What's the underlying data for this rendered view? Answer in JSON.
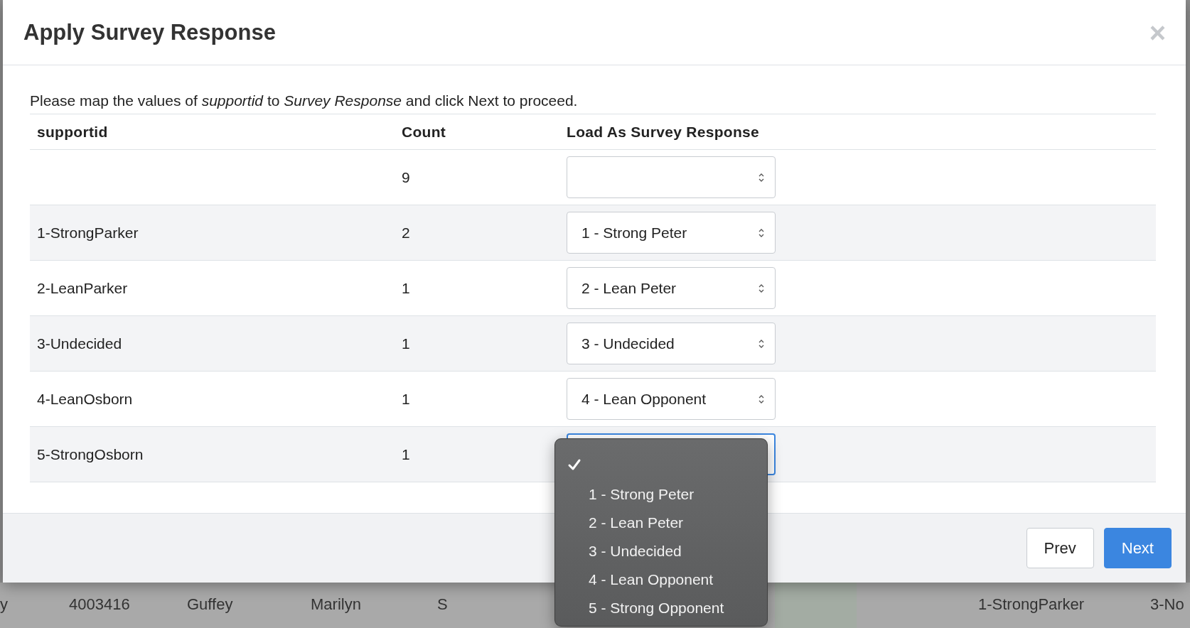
{
  "background_row": {
    "cells": [
      "y",
      "4003416",
      "Guffey",
      "Marilyn",
      "S",
      "1-StrongParker",
      "3-No"
    ]
  },
  "modal": {
    "title": "Apply Survey Response",
    "close": "×",
    "intro": "Please map the values of *supportid* to *Survey Response* and click Next to proceed.",
    "table": {
      "columns": [
        "supportid",
        "Count",
        "Load As Survey Response"
      ],
      "rows": [
        {
          "count": "9",
          "focused": false
        },
        {
          "supportid": "1-StrongParker",
          "count": "2",
          "value": "1 - Strong Peter",
          "focused": false
        },
        {
          "supportid": "2-LeanParker",
          "count": "1",
          "value": "2 - Lean Peter",
          "focused": false
        },
        {
          "supportid": "3-Undecided",
          "count": "1",
          "value": "3 - Undecided",
          "focused": false
        },
        {
          "supportid": "4-LeanOsborn",
          "count": "1",
          "value": "4 - Lean Opponent",
          "focused": false
        },
        {
          "supportid": "5-StrongOsborn",
          "count": "1",
          "focused": true
        }
      ]
    },
    "dropdown": {
      "options": [
        {
          "selected": true
        },
        {
          "label": "1 - Strong Peter",
          "selected": false
        },
        {
          "label": "2 - Lean Peter",
          "selected": false
        },
        {
          "label": "3 - Undecided",
          "selected": false
        },
        {
          "label": "4 - Lean Opponent",
          "selected": false
        },
        {
          "label": "5 - Strong Opponent",
          "selected": false
        }
      ]
    },
    "buttons": [
      {
        "label": "Prev",
        "kind": "secondary"
      },
      {
        "label": "Next",
        "kind": "primary"
      }
    ]
  }
}
